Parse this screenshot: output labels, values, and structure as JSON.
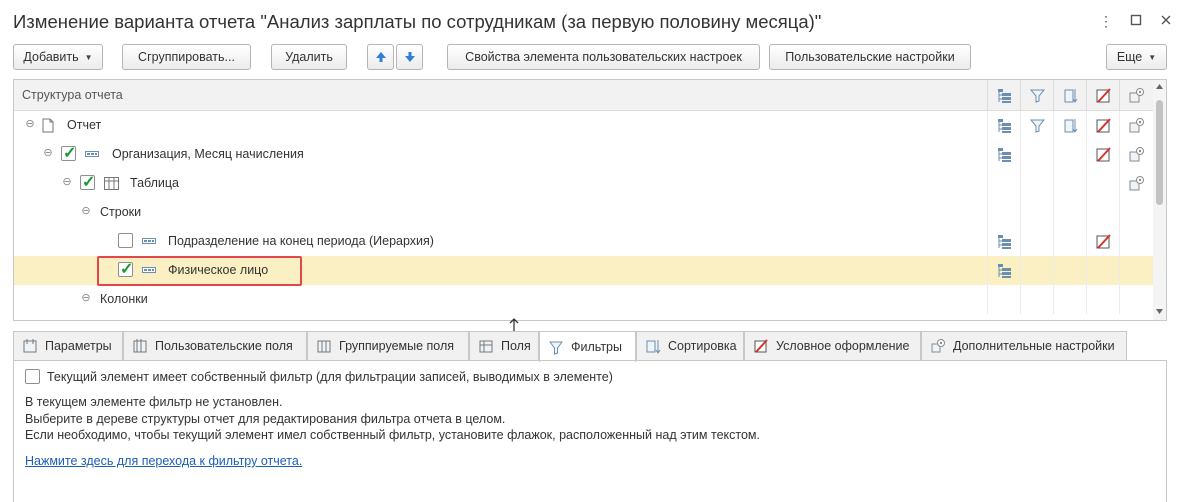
{
  "window": {
    "title": "Изменение варианта отчета \"Анализ зарплаты по сотрудникам (за первую половину месяца)\""
  },
  "toolbar": {
    "add_label": "Добавить",
    "group_label": "Сгруппировать...",
    "delete_label": "Удалить",
    "element_props_label": "Свойства элемента пользовательских настроек",
    "user_settings_label": "Пользовательские настройки",
    "more_label": "Еще"
  },
  "tree": {
    "header": "Структура отчета",
    "rows": [
      {
        "label": "Отчет"
      },
      {
        "label": "Организация, Месяц начисления",
        "checked": true
      },
      {
        "label": "Таблица",
        "checked": true
      },
      {
        "label": "Строки"
      },
      {
        "label": "Подразделение на конец периода (Иерархия)",
        "checked": false
      },
      {
        "label": "Физическое лицо",
        "checked": true,
        "selected": true
      },
      {
        "label": "Колонки"
      }
    ]
  },
  "tabs": [
    {
      "label": "Параметры",
      "icon": "parameters-icon"
    },
    {
      "label": "Пользовательские поля",
      "icon": "user-fields-icon"
    },
    {
      "label": "Группируемые поля",
      "icon": "grouped-fields-icon"
    },
    {
      "label": "Поля",
      "icon": "fields-icon"
    },
    {
      "label": "Фильтры",
      "icon": "filter-icon",
      "active": true
    },
    {
      "label": "Сортировка",
      "icon": "sort-icon"
    },
    {
      "label": "Условное оформление",
      "icon": "conditional-format-icon"
    },
    {
      "label": "Дополнительные настройки",
      "icon": "additional-settings-icon"
    }
  ],
  "filter_panel": {
    "own_filter_label": "Текущий элемент имеет собственный фильтр (для фильтрации записей, выводимых в элементе)",
    "line1": "В текущем элементе фильтр не установлен.",
    "line2": "Выберите в дереве структуры отчет для редактирования фильтра отчета в целом.",
    "line3": "Если необходимо, чтобы текущий элемент имел собственный фильтр, установите флажок, расположенный над этим текстом.",
    "link": "Нажмите здесь для перехода к фильтру отчета."
  },
  "colors": {
    "selection": "#fbf0c3",
    "highlight_border": "#e0484b",
    "link": "#1d5fb5",
    "check": "#1a9b2e"
  }
}
